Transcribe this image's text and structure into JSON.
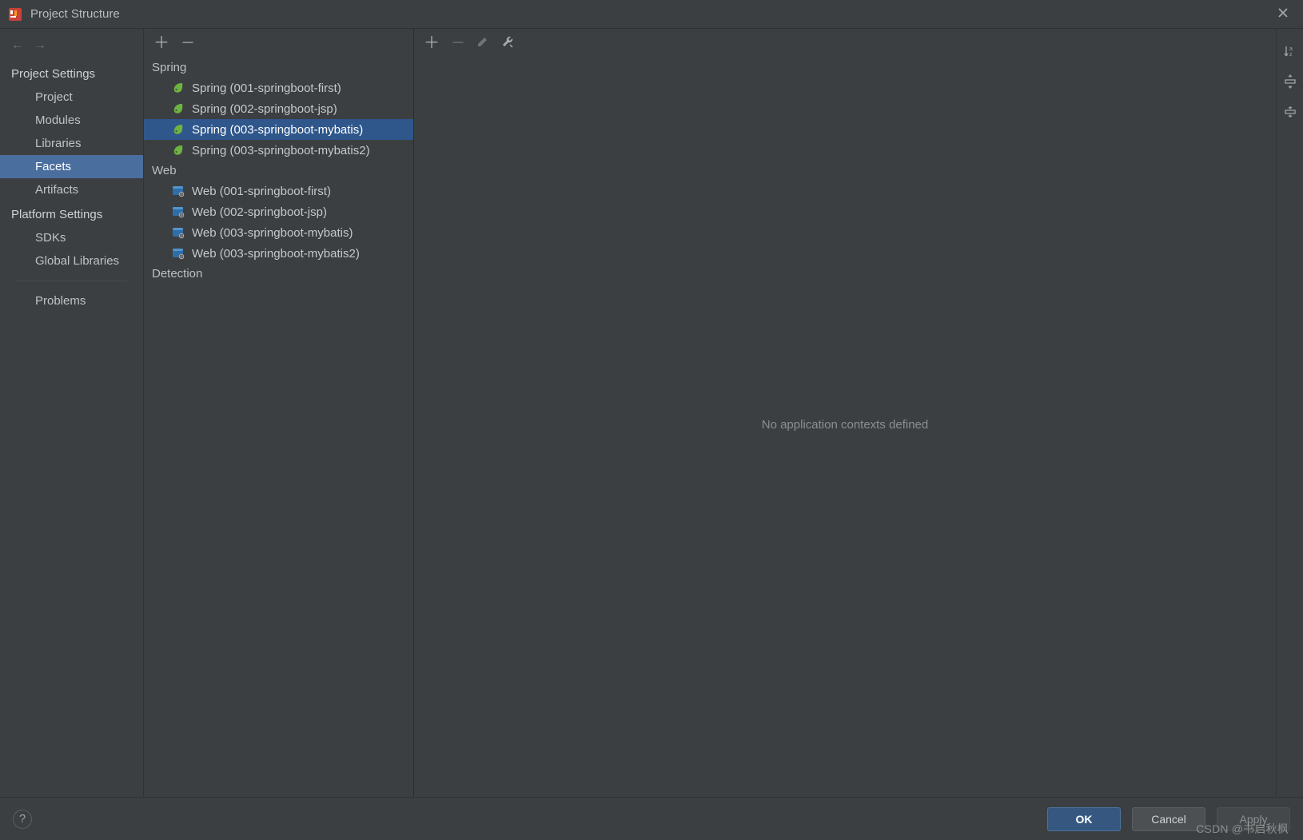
{
  "titlebar": {
    "title": "Project Structure"
  },
  "nav": {
    "section_project": "Project Settings",
    "project": "Project",
    "modules": "Modules",
    "libraries": "Libraries",
    "facets": "Facets",
    "artifacts": "Artifacts",
    "section_platform": "Platform Settings",
    "sdks": "SDKs",
    "global_libraries": "Global Libraries",
    "problems": "Problems"
  },
  "tree": {
    "groups": [
      {
        "label": "Spring",
        "icon": "spring-icon",
        "items": [
          {
            "label": "Spring (001-springboot-first)",
            "selected": false
          },
          {
            "label": "Spring (002-springboot-jsp)",
            "selected": false
          },
          {
            "label": "Spring (003-springboot-mybatis)",
            "selected": true
          },
          {
            "label": "Spring (003-springboot-mybatis2)",
            "selected": false
          }
        ]
      },
      {
        "label": "Web",
        "icon": "web-icon",
        "items": [
          {
            "label": "Web (001-springboot-first)",
            "selected": false
          },
          {
            "label": "Web (002-springboot-jsp)",
            "selected": false
          },
          {
            "label": "Web (003-springboot-mybatis)",
            "selected": false
          },
          {
            "label": "Web (003-springboot-mybatis2)",
            "selected": false
          }
        ]
      }
    ],
    "detection": "Detection"
  },
  "detail": {
    "placeholder": "No application contexts defined"
  },
  "buttons": {
    "ok": "OK",
    "cancel": "Cancel",
    "apply": "Apply"
  },
  "watermark": "CSDN @书启秋枫",
  "icons": {
    "plus": "＋",
    "minus": "－",
    "back": "←",
    "forward": "→",
    "help": "?"
  }
}
